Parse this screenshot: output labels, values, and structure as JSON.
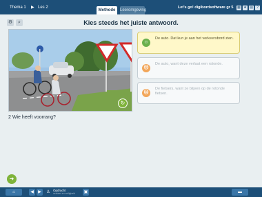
{
  "colors": {
    "topbar": "#1d4f78",
    "selected_answer": "#fff8c9",
    "accent_green": "#7fb33a",
    "accent_orange": "#f2a65a"
  },
  "header": {
    "breadcrumb": {
      "thema": "Thema 1",
      "separator": "▶",
      "les": "Les 2"
    },
    "tabs": [
      {
        "label": "Methode",
        "active": true
      },
      {
        "label": "Leeromgeving",
        "active": false
      }
    ],
    "brand": "Let's go! digibordsoftware gr 5",
    "icons": [
      "grid-icon",
      "star-icon",
      "page-icon",
      "help-icon"
    ]
  },
  "tools": {
    "settings_icon": "⚙",
    "zoom_icon": "⌕"
  },
  "main": {
    "title": "Kies steeds het juiste antwoord.",
    "photo_action_icon": "↻",
    "answers": [
      {
        "badge": "☺",
        "badge_color": "#6ab04c",
        "text": "De auto. Dat kun je aan het verkeersbord zien.",
        "selected": true
      },
      {
        "badge": "☹",
        "badge_color": "#f2a65a",
        "text": "De auto, want deze verlaat een rotonde.",
        "selected": false
      },
      {
        "badge": "☹",
        "badge_color": "#f2a65a",
        "text": "De fietsers, want ze blijven op de rotonde fietsen.",
        "selected": false
      }
    ],
    "question": "2 Wie heeft voorrang?"
  },
  "footer": {
    "next_icon": "➜",
    "label": "Opdracht",
    "sublabel": "verkeer en veiligheid"
  }
}
